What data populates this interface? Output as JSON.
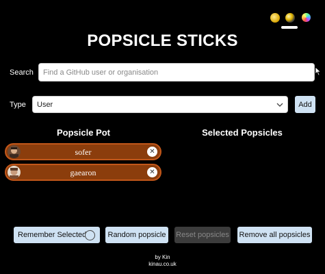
{
  "theme": {
    "icons": [
      "sun-icon",
      "moon-icon",
      "rainbow-icon"
    ],
    "selected": "dark"
  },
  "header": {
    "title": "POPSICLE STICKS"
  },
  "search": {
    "label": "Search",
    "placeholder": "Find a GitHub user or organisation",
    "value": ""
  },
  "type": {
    "label": "Type",
    "value": "User",
    "add_label": "Add"
  },
  "pot": {
    "heading": "Popsicle Pot",
    "items": [
      {
        "name": "sofer",
        "remove": "✕"
      },
      {
        "name": "gaearon",
        "remove": "✕"
      }
    ],
    "color": "#8b3d0c"
  },
  "selected": {
    "heading": "Selected Popsicles",
    "items": []
  },
  "actions": {
    "remember_label": "Remember Selected",
    "random_label": "Random popsicle",
    "reset_label": "Reset popsicles",
    "remove_all_label": "Remove all popsicles"
  },
  "footer": {
    "by": "by Kin",
    "link": "kinau.co.uk"
  },
  "colors": {
    "background": "#000000",
    "button": "#cfe2f3",
    "disabled_button": "#3c3c3c",
    "popsicle_border": "#c2571a"
  }
}
